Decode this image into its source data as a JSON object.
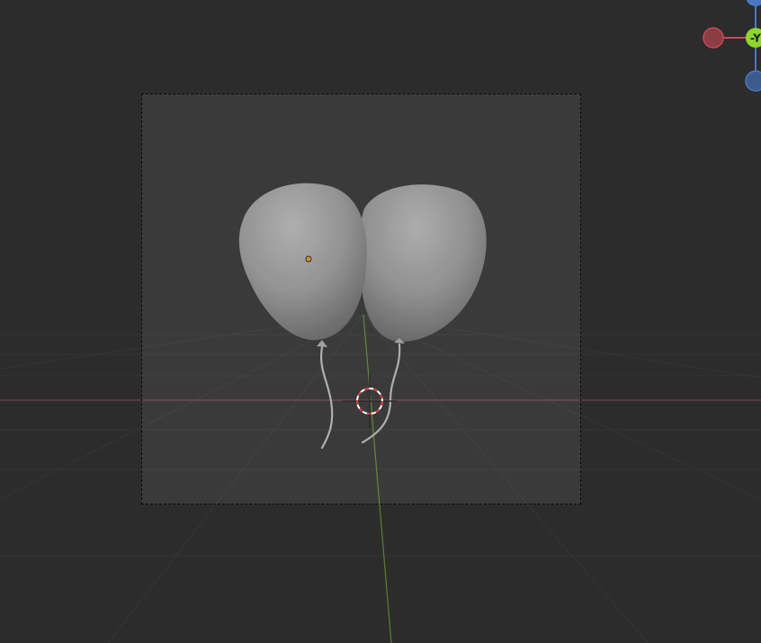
{
  "viewport": {
    "background_color": "#2c2c2c",
    "camera_frame_tint": "rgba(255,255,255,0.07)"
  },
  "gizmo": {
    "y_axis_label": "-Y",
    "x_color": "#c44b57",
    "y_color": "#8cd62f",
    "z_color": "#4a78c0"
  },
  "objects": [
    {
      "name": "balloon-left",
      "color": "#8e8e8e",
      "selected_origin": true
    },
    {
      "name": "balloon-right",
      "color": "#8e8e8e",
      "selected_origin": false
    }
  ],
  "icons": [
    "3d-cursor-icon",
    "origin-dot-icon",
    "navigation-gizmo"
  ]
}
